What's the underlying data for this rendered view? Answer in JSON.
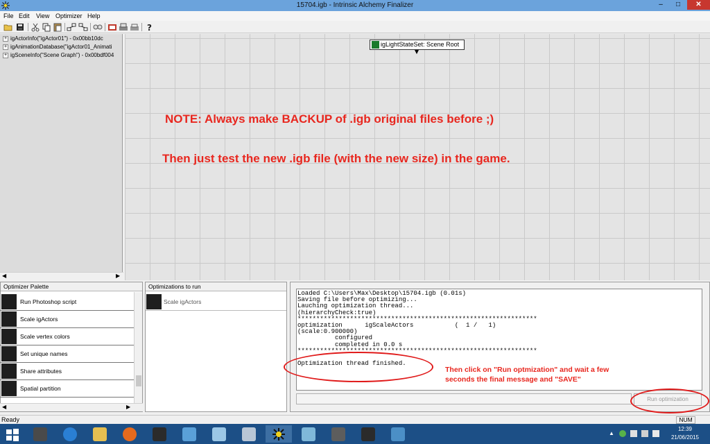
{
  "window": {
    "title": "15704.igb - Intrinsic Alchemy Finalizer",
    "min": "–",
    "max": "□",
    "close": "✕"
  },
  "menu": [
    "File",
    "Edit",
    "View",
    "Optimizer",
    "Help"
  ],
  "tree": {
    "nodes": [
      "igActorInfo(\"igActor01\") - 0x00bb10dc",
      "igAnimationDatabase(\"igActor01_Animati",
      "igSceneInfo(\"Scene Graph\") - 0x00bdf004"
    ]
  },
  "canvas": {
    "scene_node": "igLightStateSet: Scene Root",
    "note1": "NOTE: Always make BACKUP of .igb original files before ;)",
    "note2": "Then just test the new .igb file (with the new size) in the game."
  },
  "palette": {
    "header": "Optimizer Palette",
    "items": [
      "Run Photoshop script",
      "Scale igActors",
      "Scale vertex colors",
      "Set unique names",
      "Share attributes",
      "Spatial partition"
    ]
  },
  "optimizations": {
    "header": "Optimizations to run",
    "items": [
      "Scale igActors"
    ]
  },
  "log": {
    "lines": [
      "Loaded C:\\Users\\Max\\Desktop\\15704.igb (0.01s)",
      "Saving file before optimizing...",
      "Lauching optimization thread...",
      "(hierarchyCheck:true)",
      "****************************************************************",
      "optimization      igScaleActors           (  1 /   1)",
      "(scale:0.900000)",
      "          configured",
      "          completed in 0.0 s",
      "****************************************************************",
      "",
      "Optimization thread finished."
    ]
  },
  "run_button": "Run optimization",
  "annotation": {
    "line1": "Then click on \"Run optmization\" and wait a few",
    "line2": "seconds the final message and \"SAVE\""
  },
  "status": {
    "text": "Ready",
    "num": "NUM"
  },
  "clock": {
    "time": "12:39",
    "date": "21/06/2015"
  },
  "colors": {
    "annotation": "#e8271f",
    "ring": "#e01a1a",
    "taskbar": "#1c4f86"
  }
}
